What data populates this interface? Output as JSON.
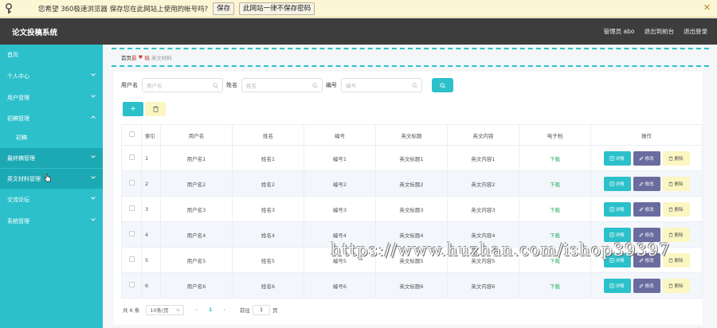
{
  "browser_bar": {
    "message": "您希望 360极速浏览器 保存您在此网站上使用的帐号吗?",
    "save_label": "保存",
    "never_label": "此网站一律不保存密码",
    "close_glyph": "✕"
  },
  "header": {
    "title": "论文投稿系统",
    "user": "管理员 abo",
    "back_label": "退出到前台",
    "logout_label": "退出登录"
  },
  "sidebar": {
    "items": [
      {
        "label": "首页",
        "has_chevron": false
      },
      {
        "label": "个人中心",
        "has_chevron": true
      },
      {
        "label": "用户管理",
        "has_chevron": true
      },
      {
        "label": "初稿管理",
        "has_chevron": true
      },
      {
        "label": "初稿",
        "has_chevron": false
      },
      {
        "label": "最终稿管理",
        "has_chevron": true
      },
      {
        "label": "英文材料管理",
        "has_chevron": true
      },
      {
        "label": "交流论坛",
        "has_chevron": true
      },
      {
        "label": "系统管理",
        "has_chevron": true
      }
    ]
  },
  "breadcrumb": {
    "home": "首页",
    "middle": "最",
    "middle2": "稿",
    "current": "英文材料"
  },
  "search": {
    "username_label": "用户名",
    "username_placeholder": "用户名",
    "name_label": "姓名",
    "name_placeholder": "姓名",
    "number_label": "编号",
    "number_placeholder": "编号"
  },
  "toolbar": {
    "add_glyph": "+",
    "delete_glyph": "🗑"
  },
  "table": {
    "headers": [
      "索引",
      "用户名",
      "姓名",
      "编号",
      "英文标题",
      "英文内容",
      "电子档",
      "操作"
    ],
    "rows": [
      {
        "index": "1",
        "username": "用户名1",
        "name": "姓名1",
        "number": "编号1",
        "title": "英文标题1",
        "content": "英文内容1",
        "file": "下载"
      },
      {
        "index": "2",
        "username": "用户名2",
        "name": "姓名2",
        "number": "编号2",
        "title": "英文标题2",
        "content": "英文内容2",
        "file": "下载"
      },
      {
        "index": "3",
        "username": "用户名3",
        "name": "姓名3",
        "number": "编号3",
        "title": "英文标题3",
        "content": "英文内容3",
        "file": "下载"
      },
      {
        "index": "4",
        "username": "用户名4",
        "name": "姓名4",
        "number": "编号4",
        "title": "英文标题4",
        "content": "英文内容4",
        "file": "下载"
      },
      {
        "index": "5",
        "username": "用户名5",
        "name": "姓名5",
        "number": "编号5",
        "title": "英文标题5",
        "content": "英文内容5",
        "file": "下载"
      },
      {
        "index": "6",
        "username": "用户名6",
        "name": "姓名6",
        "number": "编号6",
        "title": "英文标题6",
        "content": "英文内容6",
        "file": "下载"
      }
    ],
    "op_detail": "详情",
    "op_edit": "修改",
    "op_delete": "删除"
  },
  "pagination": {
    "total": "共 6 条",
    "page_size": "10条/页",
    "prev": "‹",
    "current_page": "1",
    "next": "›",
    "goto_label": "前往",
    "goto_value": "1",
    "page_suffix": "页"
  },
  "watermark": "https://www.huzhan.com/ishop39397",
  "colors": {
    "accent": "#2cc0cb",
    "header_bg": "#3d3d3d",
    "edit_button": "#6a6c9e",
    "delete_button": "#fbf6c2",
    "download_link": "#2baf6a"
  }
}
